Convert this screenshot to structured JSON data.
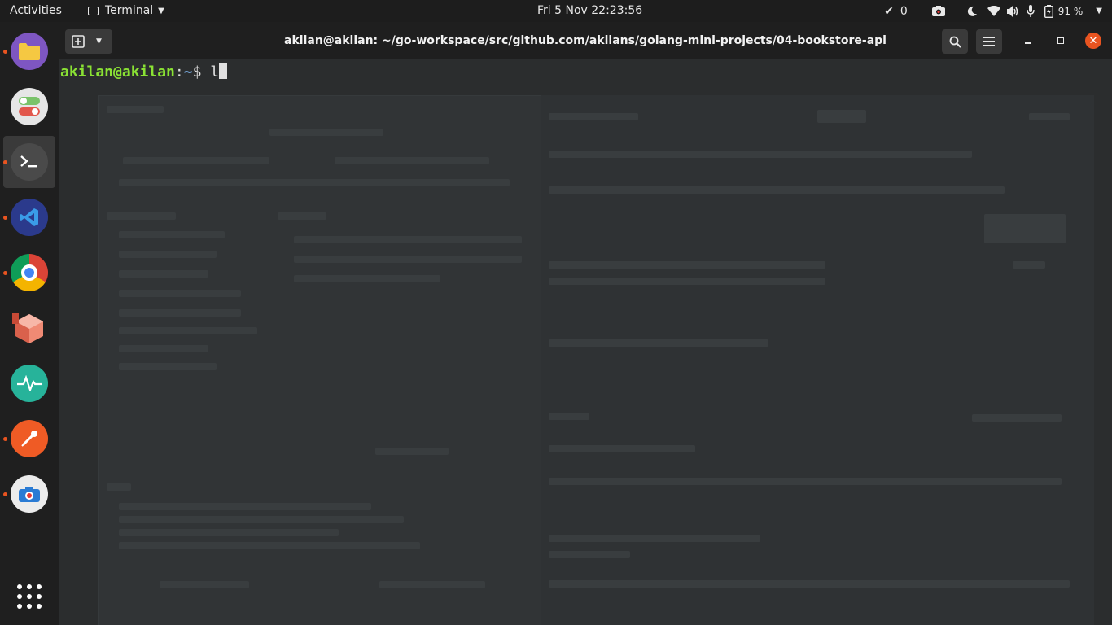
{
  "topbar": {
    "activities": "Activities",
    "app_menu": "Terminal",
    "clock": "Fri 5 Nov  22:23:56",
    "notifications_count": "0",
    "battery": "91 %"
  },
  "dock": {
    "items": [
      {
        "name": "files",
        "color": "#f5c842"
      },
      {
        "name": "settings-toggle",
        "color": "#e0e0e0"
      },
      {
        "name": "terminal",
        "color": "#3b3b3b"
      },
      {
        "name": "vscode",
        "color": "#2c74c9"
      },
      {
        "name": "chrome",
        "color": "#db4437"
      },
      {
        "name": "3d-box",
        "color": "#e66a55"
      },
      {
        "name": "monitor",
        "color": "#27b39a"
      },
      {
        "name": "postman",
        "color": "#ef5b25"
      },
      {
        "name": "camera",
        "color": "#e8e8e8"
      }
    ],
    "show_apps_icon": "grid-icon"
  },
  "terminal": {
    "title": "akilan@akilan: ~/go-workspace/src/github.com/akilans/golang-mini-projects/04-bookstore-api",
    "prompt_user": "akilan@akilan",
    "prompt_sep": ":",
    "prompt_path": "~",
    "prompt_symbol": "$ ",
    "input": "l"
  }
}
